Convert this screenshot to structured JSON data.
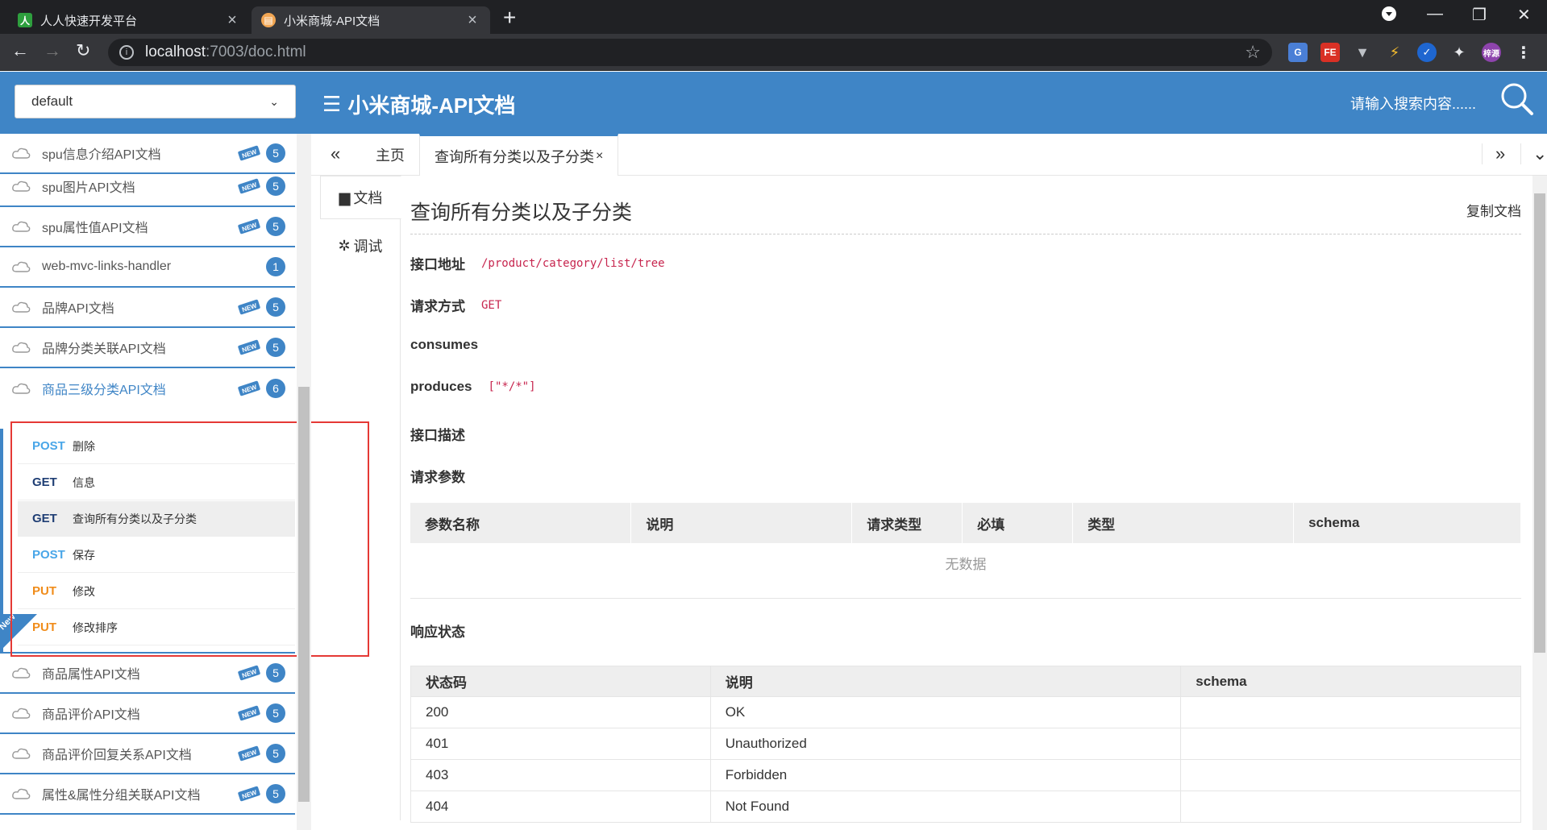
{
  "browser": {
    "tabs": [
      {
        "title": "人人快速开发平台",
        "favicon": "人"
      },
      {
        "title": "小米商城-API文档"
      }
    ],
    "url_host": "localhost",
    "url_path": ":7003/doc.html",
    "profile_label": "梓源",
    "ext_labels": {
      "translate": "G",
      "fe": "FE"
    }
  },
  "header": {
    "group_select": "default",
    "title": "小米商城-API文档",
    "search_placeholder": "请输入搜索内容......"
  },
  "sidebar": {
    "items_above": [
      {
        "label": "spu信息介绍API文档",
        "count": "5",
        "new": true
      },
      {
        "label": "spu图片API文档",
        "count": "5",
        "new": true
      },
      {
        "label": "spu属性值API文档",
        "count": "5",
        "new": true
      },
      {
        "label": "web-mvc-links-handler",
        "count": "1",
        "new": false
      },
      {
        "label": "品牌API文档",
        "count": "5",
        "new": true
      },
      {
        "label": "品牌分类关联API文档",
        "count": "5",
        "new": true
      },
      {
        "label": "商品三级分类API文档",
        "count": "6",
        "new": true,
        "active": true
      }
    ],
    "operations": [
      {
        "method": "POST",
        "desc": "删除"
      },
      {
        "method": "GET",
        "desc": "信息"
      },
      {
        "method": "GET",
        "desc": "查询所有分类以及子分类",
        "selected": true
      },
      {
        "method": "POST",
        "desc": "保存"
      },
      {
        "method": "PUT",
        "desc": "修改"
      },
      {
        "method": "PUT",
        "desc": "修改排序",
        "new": true
      }
    ],
    "new_ribbon": "New",
    "items_below": [
      {
        "label": "商品属性API文档",
        "count": "5",
        "new": true
      },
      {
        "label": "商品评价API文档",
        "count": "5",
        "new": true
      },
      {
        "label": "商品评价回复关系API文档",
        "count": "5",
        "new": true
      },
      {
        "label": "属性&属性分组关联API文档",
        "count": "5",
        "new": true
      }
    ]
  },
  "content_tabs": {
    "home": "主页",
    "current": "查询所有分类以及子分类"
  },
  "side_tabs": {
    "doc": "文档",
    "debug": "调试"
  },
  "doc": {
    "title": "查询所有分类以及子分类",
    "copy_label": "复制文档",
    "address_label": "接口地址",
    "address": "/product/category/list/tree",
    "method_label": "请求方式",
    "method": "GET",
    "consumes_label": "consumes",
    "produces_label": "produces",
    "produces": "[\"*/*\"]",
    "description_label": "接口描述",
    "params_label": "请求参数",
    "param_headers": [
      "参数名称",
      "说明",
      "请求类型",
      "必填",
      "类型",
      "schema"
    ],
    "no_data": "无数据",
    "response_label": "响应状态",
    "response_headers": [
      "状态码",
      "说明",
      "schema"
    ],
    "responses": [
      {
        "code": "200",
        "desc": "OK",
        "schema": ""
      },
      {
        "code": "401",
        "desc": "Unauthorized",
        "schema": ""
      },
      {
        "code": "403",
        "desc": "Forbidden",
        "schema": ""
      },
      {
        "code": "404",
        "desc": "Not Found",
        "schema": ""
      }
    ]
  },
  "colors": {
    "accent": "#3f85c6",
    "post": "#49a6e8",
    "get": "#1f3e74",
    "put": "#f08c1a",
    "highlight_box": "#e53935"
  }
}
